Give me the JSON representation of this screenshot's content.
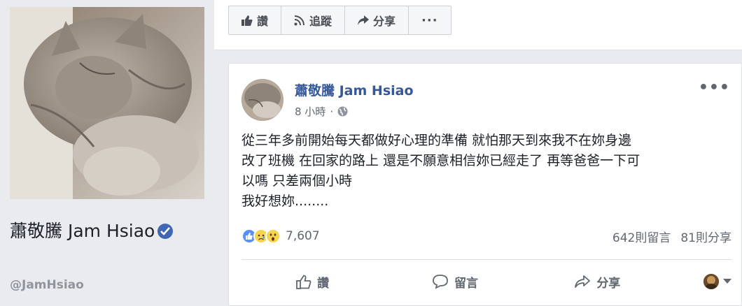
{
  "profile": {
    "name": "蕭敬騰 Jam Hsiao",
    "handle": "@JamHsiao"
  },
  "toolbar": {
    "like_label": "讚",
    "follow_label": "追蹤",
    "share_label": "分享",
    "more_label": "···"
  },
  "post": {
    "author": "蕭敬騰 Jam Hsiao",
    "time": "8 小時",
    "separator": "·",
    "more": "•••",
    "text_lines": [
      "從三年多前開始每天都做好心理的準備 就怕那天到來我不在妳身邊",
      "改了班機 在回家的路上 還是不願意相信妳已經走了 再等爸爸一下可",
      "以嗎 只差兩個小時",
      "我好想妳........"
    ],
    "reaction_count": "7,607",
    "comments": "642則留言",
    "shares": "81則分享",
    "actions": {
      "like": "讚",
      "comment": "留言",
      "share": "分享"
    }
  },
  "colors": {
    "brand_blue": "#4267b2",
    "link_blue": "#365899",
    "background": "#e9ebee"
  }
}
